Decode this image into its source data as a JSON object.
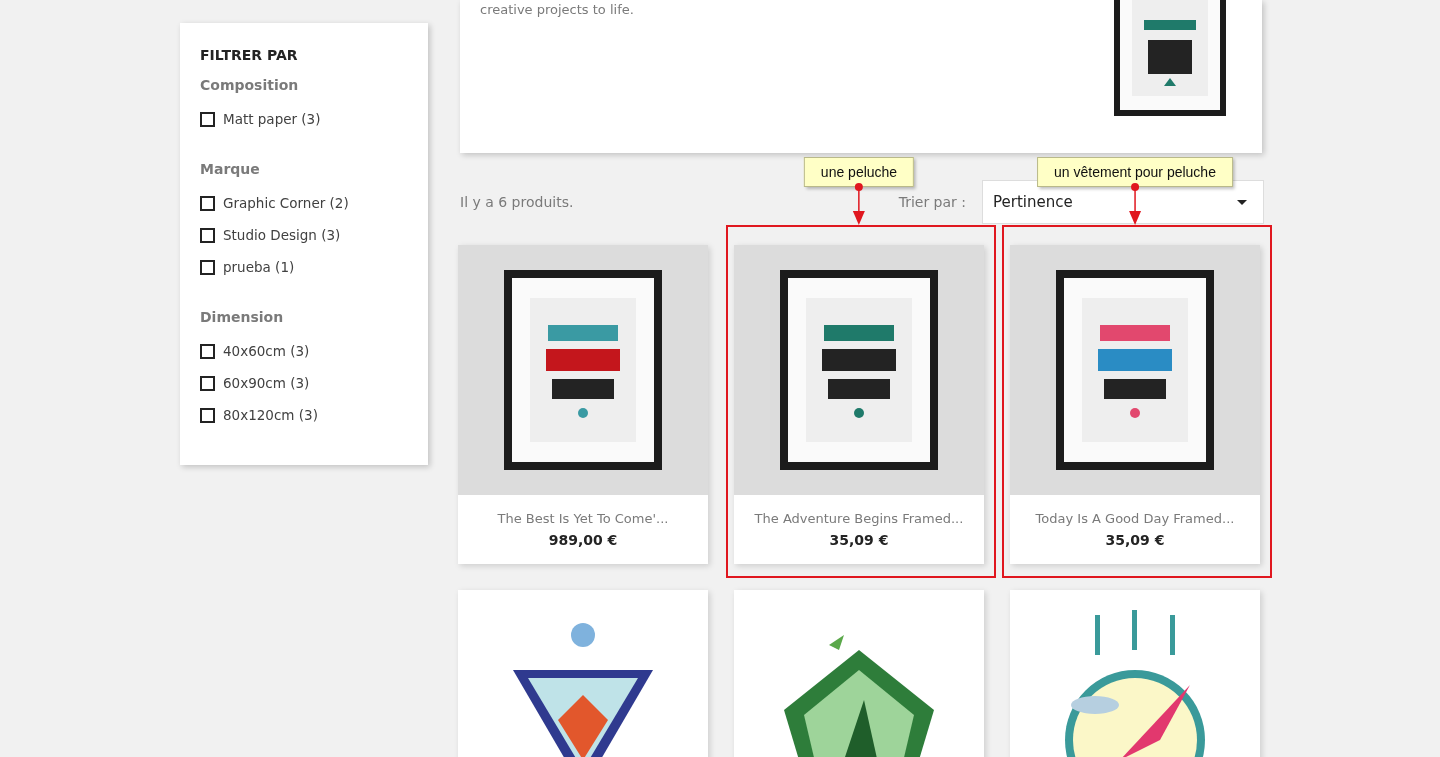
{
  "intro": {
    "text": "creative projects to life."
  },
  "filters": {
    "title": "FILTRER PAR",
    "groups": [
      {
        "name": "Composition",
        "options": [
          {
            "label": "Matt paper (3)",
            "checked": false
          }
        ]
      },
      {
        "name": "Marque",
        "options": [
          {
            "label": "Graphic Corner (2)",
            "checked": false
          },
          {
            "label": "Studio Design (3)",
            "checked": false
          },
          {
            "label": "prueba (1)",
            "checked": false
          }
        ]
      },
      {
        "name": "Dimension",
        "options": [
          {
            "label": "40x60cm (3)",
            "checked": false
          },
          {
            "label": "60x90cm (3)",
            "checked": false
          },
          {
            "label": "80x120cm (3)",
            "checked": false
          }
        ]
      }
    ]
  },
  "listing": {
    "count": "Il y a 6 produits.",
    "sort_label": "Trier par :",
    "sort_value": "Pertinence"
  },
  "products": [
    {
      "name": "The Best Is Yet To Come'...",
      "price": "989,00 €"
    },
    {
      "name": "The Adventure Begins Framed...",
      "price": "35,09 €",
      "annotation": "une peluche"
    },
    {
      "name": "Today Is A Good Day Framed...",
      "price": "35,09 €",
      "annotation": "un vêtement pour peluche"
    }
  ]
}
